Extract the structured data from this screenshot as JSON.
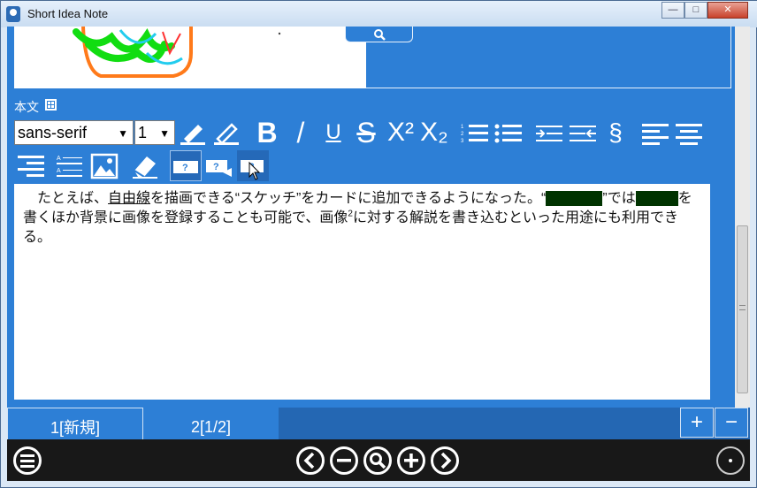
{
  "window": {
    "title": "Short Idea Note",
    "minimize": "—",
    "maximize": "□",
    "close": "✕"
  },
  "body_label": "本文",
  "toolbar": {
    "font_family": "sans-serif",
    "font_size": "1",
    "buttons": [
      {
        "name": "highlight-pen-icon"
      },
      {
        "name": "pen-icon"
      },
      {
        "name": "bold-icon",
        "glyph": "B"
      },
      {
        "name": "italic-icon",
        "glyph": "/"
      },
      {
        "name": "underline-icon",
        "glyph": "U"
      },
      {
        "name": "strikethrough-icon",
        "glyph": "S"
      },
      {
        "name": "superscript-icon",
        "glyph": "X²"
      },
      {
        "name": "subscript-icon",
        "glyph": "X₂"
      }
    ]
  },
  "editor": {
    "p1": "たとえば、",
    "link": "自由線",
    "p2": "を描画できる“スケッチ”をカードに追加できるようになった。“",
    "p3": "”では",
    "p4": "を",
    "p5": "書くほか背景に画像を登録することも可能で、画像",
    "sup": "2",
    "p6": "に対する解説を書き込むといった用途にも利用でき",
    "p7": "る。"
  },
  "tabs": [
    {
      "label": "1[新規]"
    },
    {
      "label": "2[1/2]"
    }
  ],
  "tab_add": "+",
  "tab_remove": "−",
  "colors": {
    "accent": "#2d7fd6",
    "tab_dark": "#2467b3",
    "bottom_bar": "#181818"
  }
}
